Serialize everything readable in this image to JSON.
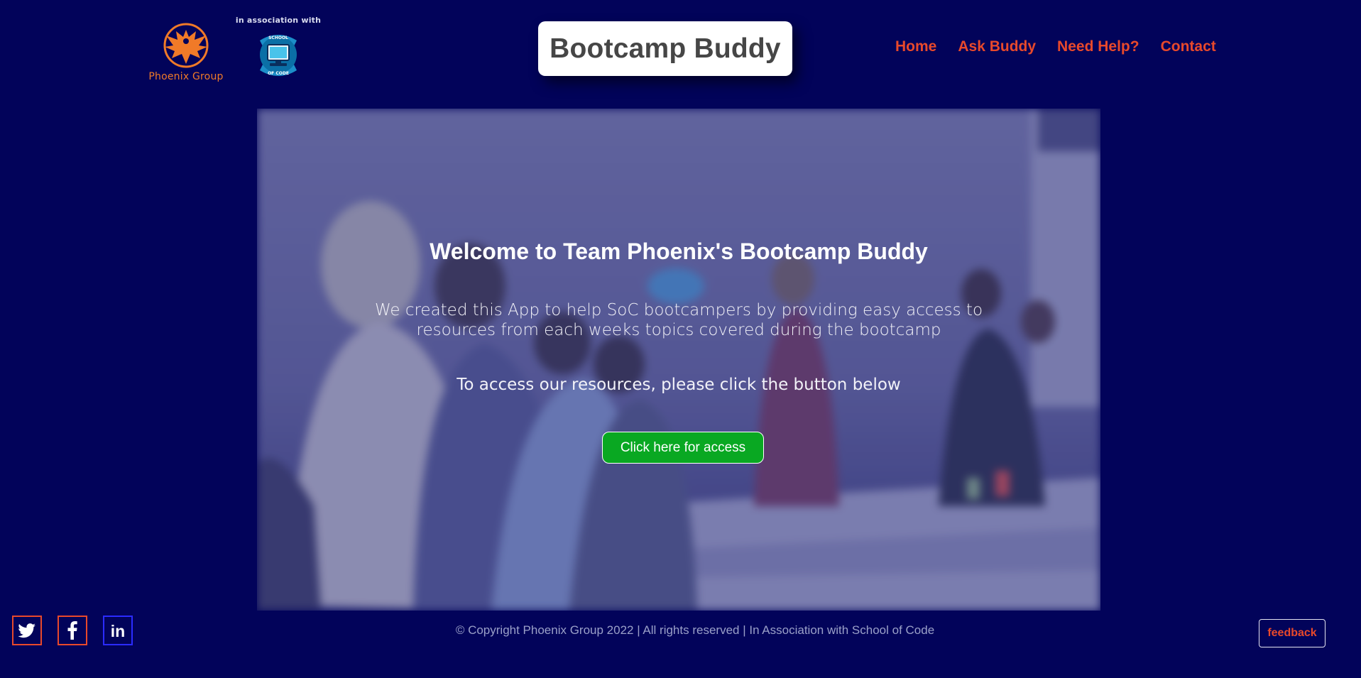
{
  "header": {
    "logo_text": "Phoenix Group",
    "association_text": "in association with",
    "soc_logo_text_top": "SCHOOL",
    "soc_logo_text_bottom": "OF CODE",
    "title": "Bootcamp Buddy"
  },
  "nav": {
    "items": [
      {
        "label": "Home"
      },
      {
        "label": "Ask Buddy"
      },
      {
        "label": "Need Help?"
      },
      {
        "label": "Contact"
      }
    ]
  },
  "hero": {
    "heading": "Welcome to Team Phoenix's Bootcamp Buddy",
    "description": "We created this App to help SoC bootcampers by providing easy access to resources from each weeks topics covered during the bootcamp",
    "access_text": "To access our resources, please click the button below",
    "button_label": "Click here for access"
  },
  "footer": {
    "social": [
      {
        "icon": "twitter-icon"
      },
      {
        "icon": "facebook-icon"
      },
      {
        "icon": "linkedin-icon",
        "glyph": "in"
      }
    ],
    "copyright": "© Copyright Phoenix Group 2022 | All rights reserved | In Association with School of Code",
    "feedback_label": "feedback"
  },
  "colors": {
    "background": "#02035a",
    "accent": "#e8492b",
    "button": "#09a822",
    "title_text": "#464646",
    "logo_orange": "#f07a28"
  }
}
